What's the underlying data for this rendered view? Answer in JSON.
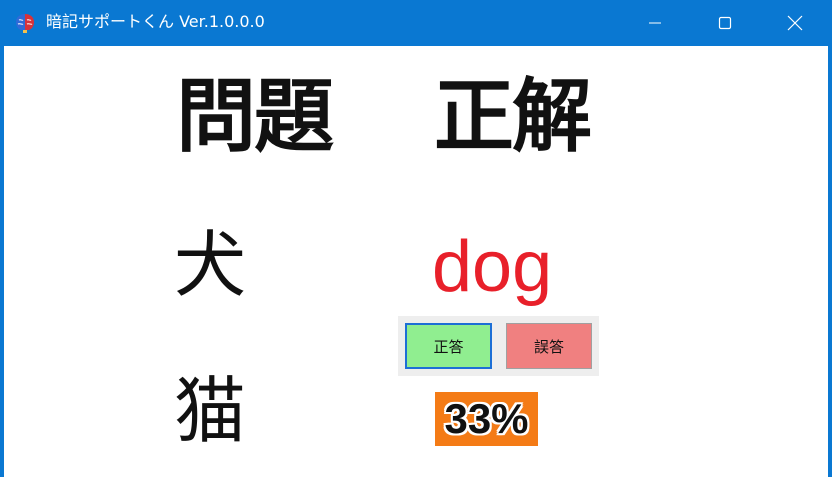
{
  "window": {
    "title": "暗記サポートくん Ver.1.0.0.0",
    "icon": "brain-icon",
    "controls": [
      "minimize-icon",
      "maximize-icon",
      "close-icon"
    ]
  },
  "headers": {
    "question": "問題",
    "answer": "正解"
  },
  "current": {
    "question": "犬",
    "answer": "dog"
  },
  "next": {
    "question": "猫"
  },
  "buttons": {
    "correct": "正答",
    "wrong": "誤答"
  },
  "progress": {
    "label": "33%",
    "value": 33
  },
  "colors": {
    "titlebar": "#0a78d2",
    "answer_text": "#e8202a",
    "correct_button": "#90ee90",
    "wrong_button": "#f08080",
    "progress_bg": "#f47b16"
  }
}
